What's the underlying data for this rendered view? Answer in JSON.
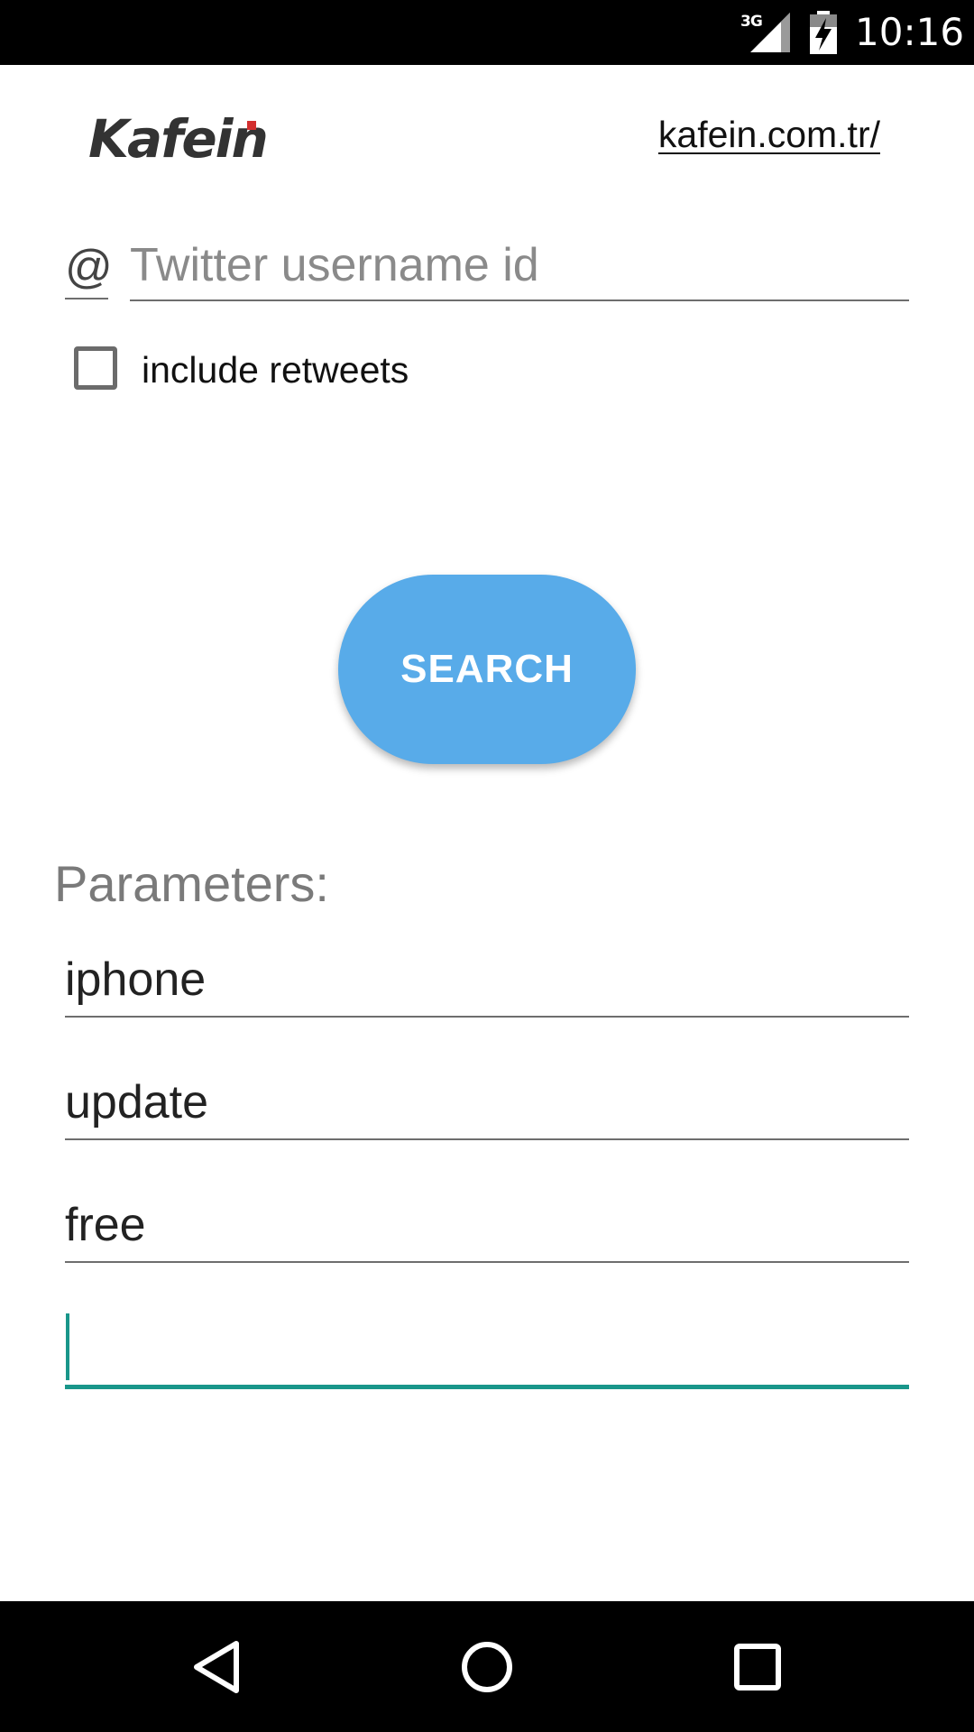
{
  "status_bar": {
    "network": "3G",
    "time": "10:16",
    "signal_icon": "cell-signal-icon",
    "battery_icon": "battery-charging-icon"
  },
  "header": {
    "logo_text": "Kafein",
    "link_text": "kafein.com.tr/"
  },
  "username": {
    "prefix": "@",
    "placeholder": "Twitter username id",
    "value": ""
  },
  "retweets": {
    "label": "include retweets",
    "checked": false
  },
  "search_button": {
    "label": "SEARCH",
    "color": "#58abe9"
  },
  "parameters": {
    "title": "Parameters:",
    "fields": [
      {
        "value": "iphone"
      },
      {
        "value": "update"
      },
      {
        "value": "free"
      },
      {
        "value": ""
      }
    ],
    "focus_color": "#19968a"
  },
  "nav_bar": {
    "back_icon": "back-triangle-icon",
    "home_icon": "home-circle-icon",
    "recents_icon": "recents-square-icon"
  }
}
